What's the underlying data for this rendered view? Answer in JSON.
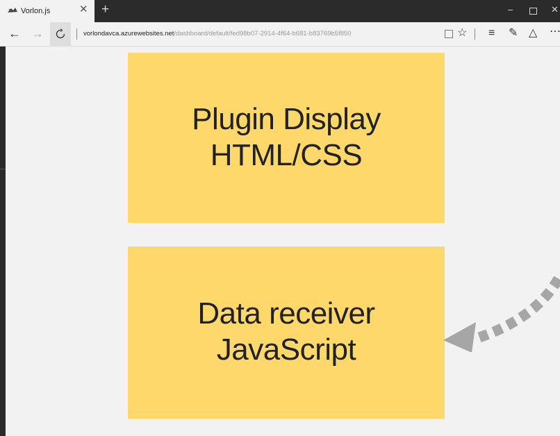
{
  "tab": {
    "title": "Vorlon.js",
    "close": "✕",
    "new_tab": "+"
  },
  "window_controls": {
    "minimize": "–",
    "close": "✕"
  },
  "nav": {
    "back": "←",
    "forward": "→",
    "refresh_icon": "refresh-icon"
  },
  "address": {
    "host": "vorlondavca.azurewebsites.net",
    "path": "/dashboard/default/fed98b07-2914-4f64-b681-b83769b5f850"
  },
  "toolbar": {
    "favorite": "☆",
    "hub": "≡",
    "note": "✎",
    "share": "△",
    "more": "⋯"
  },
  "panels": [
    {
      "line1": "Plugin Display",
      "line2": "HTML/CSS"
    },
    {
      "line1": "Data receiver",
      "line2": "JavaScript"
    }
  ],
  "colors": {
    "panel": "#fed86a",
    "arrow": "#a6a6a6",
    "chrome_dark": "#2b2b2b"
  }
}
